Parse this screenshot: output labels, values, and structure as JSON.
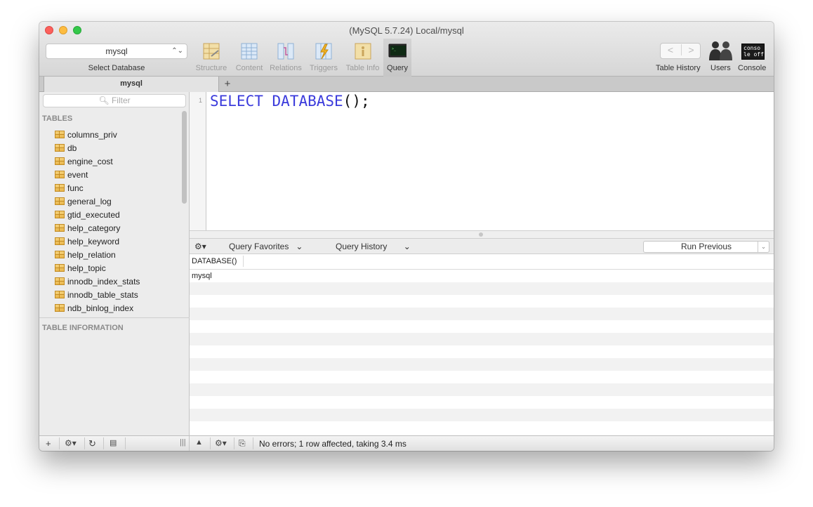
{
  "window": {
    "title": "(MySQL 5.7.24) Local/mysql"
  },
  "database": {
    "selected": "mysql",
    "caption": "Select Database"
  },
  "toolbar": {
    "tools": [
      {
        "label": "Structure",
        "icon": "structure-icon"
      },
      {
        "label": "Content",
        "icon": "content-icon"
      },
      {
        "label": "Relations",
        "icon": "relations-icon"
      },
      {
        "label": "Triggers",
        "icon": "triggers-icon"
      },
      {
        "label": "Table Info",
        "icon": "table-info-icon"
      },
      {
        "label": "Query",
        "icon": "query-terminal-icon",
        "active": true
      }
    ],
    "right": {
      "history_label": "Table History",
      "users_label": "Users",
      "console_label": "Console",
      "console_badge": "conso le off"
    },
    "nav": {
      "back": "<",
      "forward": ">"
    }
  },
  "tabs": {
    "active": "mysql",
    "add": "+"
  },
  "sidebar": {
    "filter_placeholder": "Filter",
    "tables_header": "TABLES",
    "tables": [
      "columns_priv",
      "db",
      "engine_cost",
      "event",
      "func",
      "general_log",
      "gtid_executed",
      "help_category",
      "help_keyword",
      "help_relation",
      "help_topic",
      "innodb_index_stats",
      "innodb_table_stats",
      "ndb_binlog_index"
    ],
    "info_header": "TABLE INFORMATION"
  },
  "editor": {
    "line_number": "1",
    "keyword1": "SELECT",
    "keyword2": "DATABASE",
    "punct": "();"
  },
  "query_bar": {
    "favorites": "Query Favorites",
    "history": "Query History",
    "run_previous": "Run Previous"
  },
  "results": {
    "column": "DATABASE()",
    "rows": [
      "mysql"
    ]
  },
  "status": {
    "message": "No errors; 1 row affected, taking 3.4 ms"
  },
  "colors": {
    "keyword": "#3b3bdc",
    "table_icon": "#e9b64c"
  }
}
